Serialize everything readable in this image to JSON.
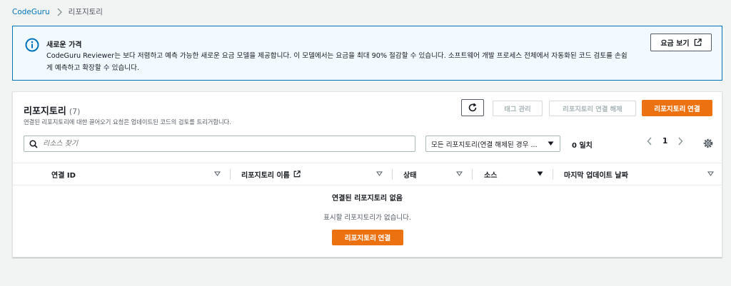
{
  "breadcrumb": {
    "root": "CodeGuru",
    "current": "리포지토리"
  },
  "flash": {
    "title": "새로운 가격",
    "body": "CodeGuru Reviewer는 보다 저렴하고 예측 가능한 새로운 요금 모델을 제공합니다. 이 모델에서는 요금을 최대 90% 절감할 수 있습니다. 소프트웨어 개발 프로세스 전체에서 자동화된 코드 검토를 손쉽게 예측하고 확장할 수 있습니다.",
    "button_label": "요금 보기"
  },
  "panel": {
    "title": "리포지토리",
    "count": "(7)",
    "description": "연결된 리포지토리에 대한 끌어오기 요청은 업데이트된 코드의 검토를 트리거합니다.",
    "tags_label": "태그 관리",
    "disconnect_label": "리포지토리 연결 해제",
    "connect_label": "리포지토리 연결"
  },
  "filter": {
    "search_placeholder": "리소스 찾기",
    "select_value": "모든 리포지토리(연결 해제된 경우 ...",
    "match_count": "0 일치",
    "page": "1"
  },
  "table": {
    "columns": [
      "연결 ID",
      "리포지토리 이름",
      "상태",
      "소스",
      "마지막 업데이트 날짜"
    ]
  },
  "empty": {
    "title": "연결된 리포지토리 없음",
    "description": "표시할 리포지토리가 없습니다.",
    "button_label": "리포지토리 연결"
  },
  "colors": {
    "primary": "#ec7211",
    "link": "#0073bb",
    "info_bg": "#f1faff"
  }
}
